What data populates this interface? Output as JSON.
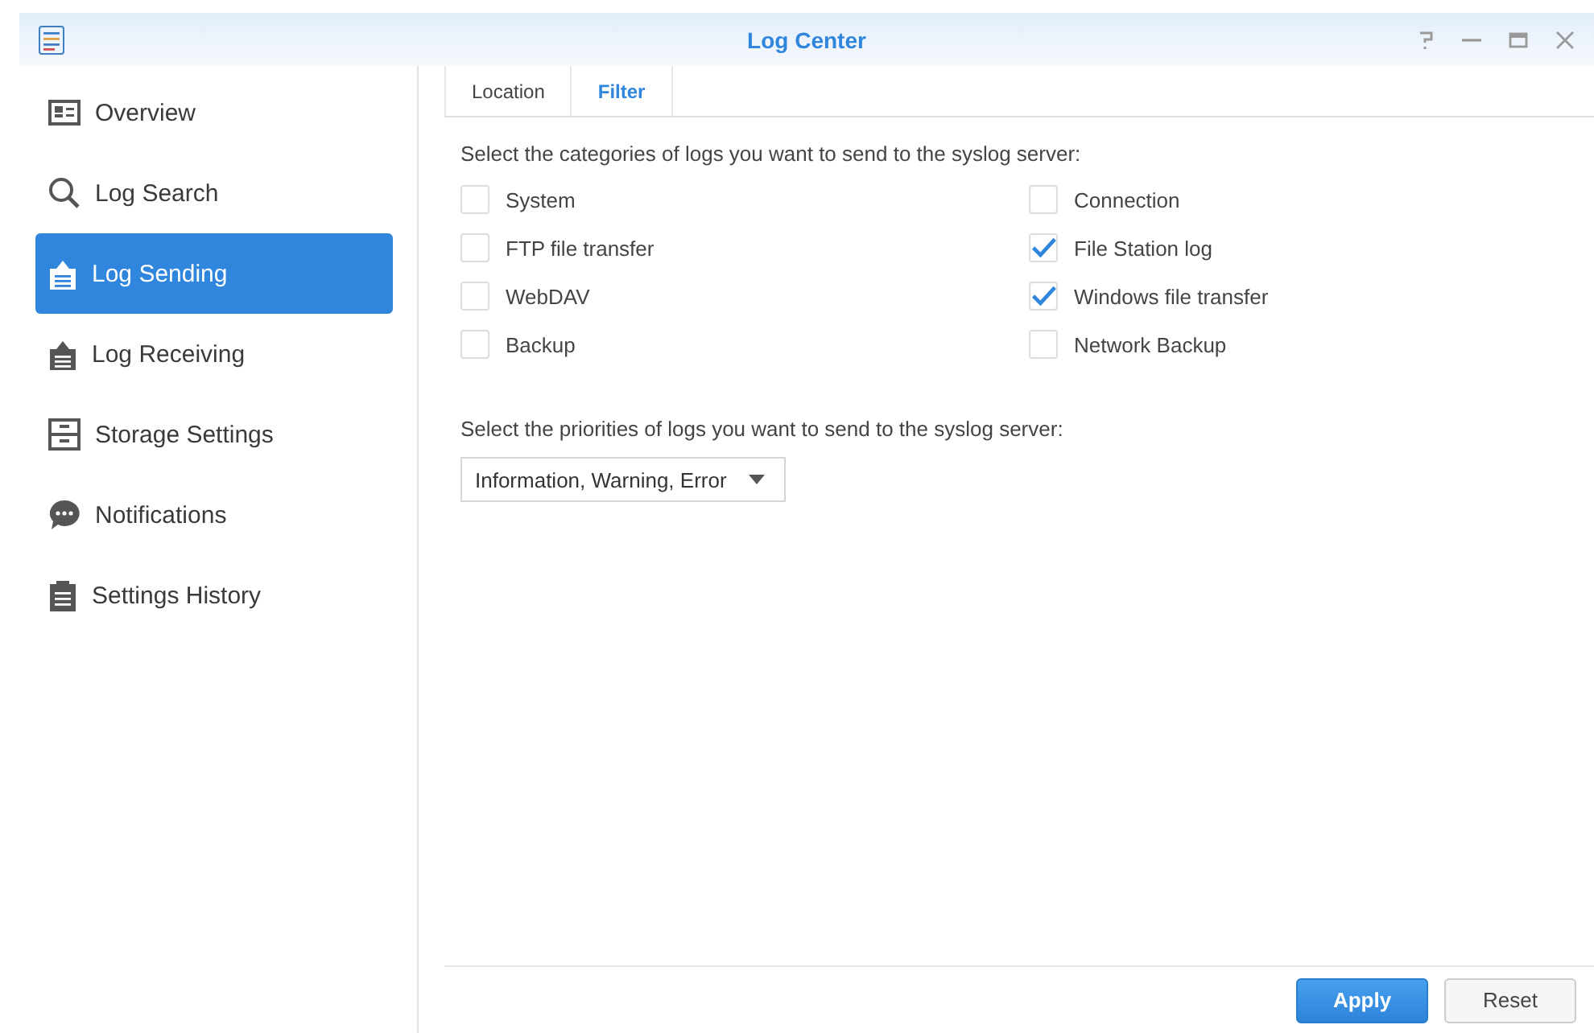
{
  "window": {
    "title": "Log Center"
  },
  "sidebar": {
    "items": [
      {
        "label": "Overview",
        "selected": false
      },
      {
        "label": "Log Search",
        "selected": false
      },
      {
        "label": "Log Sending",
        "selected": true
      },
      {
        "label": "Log Receiving",
        "selected": false
      },
      {
        "label": "Storage Settings",
        "selected": false
      },
      {
        "label": "Notifications",
        "selected": false
      },
      {
        "label": "Settings History",
        "selected": false
      }
    ]
  },
  "tabs": [
    {
      "label": "Location",
      "selected": false
    },
    {
      "label": "Filter",
      "selected": true
    }
  ],
  "categories": {
    "prompt": "Select the categories of logs you want to send to the syslog server:",
    "items": [
      {
        "label": "System",
        "checked": false
      },
      {
        "label": "Connection",
        "checked": false
      },
      {
        "label": "FTP file transfer",
        "checked": false
      },
      {
        "label": "File Station log",
        "checked": true
      },
      {
        "label": "WebDAV",
        "checked": false
      },
      {
        "label": "Windows file transfer",
        "checked": true
      },
      {
        "label": "Backup",
        "checked": false
      },
      {
        "label": "Network Backup",
        "checked": false
      }
    ]
  },
  "priorities": {
    "prompt": "Select the priorities of logs you want to send to the syslog server:",
    "value": "Information, Warning, Error"
  },
  "buttons": [
    {
      "label": "Apply",
      "kind": "primary"
    },
    {
      "label": "Reset",
      "kind": "secondary"
    }
  ]
}
